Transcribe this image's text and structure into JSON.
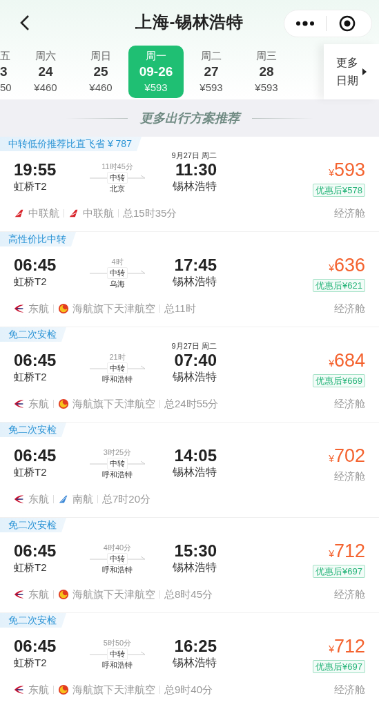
{
  "header": {
    "title": "上海-锡林浩特"
  },
  "dates": [
    {
      "weekday": "五",
      "day": "3",
      "price": "50",
      "selected": false
    },
    {
      "weekday": "周六",
      "day": "24",
      "price": "¥460",
      "selected": false
    },
    {
      "weekday": "周日",
      "day": "25",
      "price": "¥460",
      "selected": false
    },
    {
      "weekday": "周一",
      "day": "09-26",
      "price": "¥593",
      "selected": true
    },
    {
      "weekday": "周二",
      "day": "27",
      "price": "¥593",
      "selected": false
    },
    {
      "weekday": "周三",
      "day": "28",
      "price": "¥593",
      "selected": false
    }
  ],
  "more_dates": {
    "line1": "更多",
    "line2": "日期"
  },
  "section_title": "更多出行方案推荐",
  "flights": [
    {
      "tag": "中转低价推荐比直飞省 ¥ 787",
      "depart_time": "19:55",
      "depart_airport": "虹桥T2",
      "duration": "11时45分",
      "transfer_label": "中转",
      "transfer_city": "北京",
      "arrival_date": "9月27日 周二",
      "arrive_time": "11:30",
      "arrive_airport": "锡林浩特",
      "currency": "¥",
      "price": "593",
      "discount": "优惠后¥578",
      "cabin": "经济舱",
      "airlines": [
        {
          "name": "中联航",
          "kind": "redtail"
        },
        {
          "name": "中联航",
          "kind": "redtail"
        }
      ],
      "total": "总15时35分"
    },
    {
      "tag": "高性价比中转",
      "depart_time": "06:45",
      "depart_airport": "虹桥T2",
      "duration": "4时",
      "transfer_label": "中转",
      "transfer_city": "乌海",
      "arrive_time": "17:45",
      "arrive_airport": "锡林浩特",
      "currency": "¥",
      "price": "636",
      "discount": "优惠后¥621",
      "cabin": "经济舱",
      "airlines": [
        {
          "name": "东航",
          "kind": "swallow"
        },
        {
          "name": "海航旗下天津航空",
          "kind": "suncircle"
        }
      ],
      "total": "总11时"
    },
    {
      "tag": "免二次安检",
      "depart_time": "06:45",
      "depart_airport": "虹桥T2",
      "duration": "21时",
      "transfer_label": "中转",
      "transfer_city": "呼和浩特",
      "arrival_date": "9月27日 周二",
      "arrive_time": "07:40",
      "arrive_airport": "锡林浩特",
      "currency": "¥",
      "price": "684",
      "discount": "优惠后¥669",
      "cabin": "经济舱",
      "airlines": [
        {
          "name": "东航",
          "kind": "swallow"
        },
        {
          "name": "海航旗下天津航空",
          "kind": "suncircle"
        }
      ],
      "total": "总24时55分"
    },
    {
      "tag": "免二次安检",
      "depart_time": "06:45",
      "depart_airport": "虹桥T2",
      "duration": "3时25分",
      "transfer_label": "中转",
      "transfer_city": "呼和浩特",
      "arrive_time": "14:05",
      "arrive_airport": "锡林浩特",
      "currency": "¥",
      "price": "702",
      "cabin": "经济舱",
      "airlines": [
        {
          "name": "东航",
          "kind": "swallow"
        },
        {
          "name": "南航",
          "kind": "bluetail"
        }
      ],
      "total": "总7时20分"
    },
    {
      "tag": "免二次安检",
      "depart_time": "06:45",
      "depart_airport": "虹桥T2",
      "duration": "4时40分",
      "transfer_label": "中转",
      "transfer_city": "呼和浩特",
      "arrive_time": "15:30",
      "arrive_airport": "锡林浩特",
      "currency": "¥",
      "price": "712",
      "discount": "优惠后¥697",
      "cabin": "经济舱",
      "airlines": [
        {
          "name": "东航",
          "kind": "swallow"
        },
        {
          "name": "海航旗下天津航空",
          "kind": "suncircle"
        }
      ],
      "total": "总8时45分"
    },
    {
      "tag": "免二次安检",
      "depart_time": "06:45",
      "depart_airport": "虹桥T2",
      "duration": "5时50分",
      "transfer_label": "中转",
      "transfer_city": "呼和浩特",
      "arrive_time": "16:25",
      "arrive_airport": "锡林浩特",
      "currency": "¥",
      "price": "712",
      "discount": "优惠后¥697",
      "cabin": "经济舱",
      "airlines": [
        {
          "name": "东航",
          "kind": "swallow"
        },
        {
          "name": "海航旗下天津航空",
          "kind": "suncircle"
        }
      ],
      "total": "总9时40分"
    }
  ]
}
